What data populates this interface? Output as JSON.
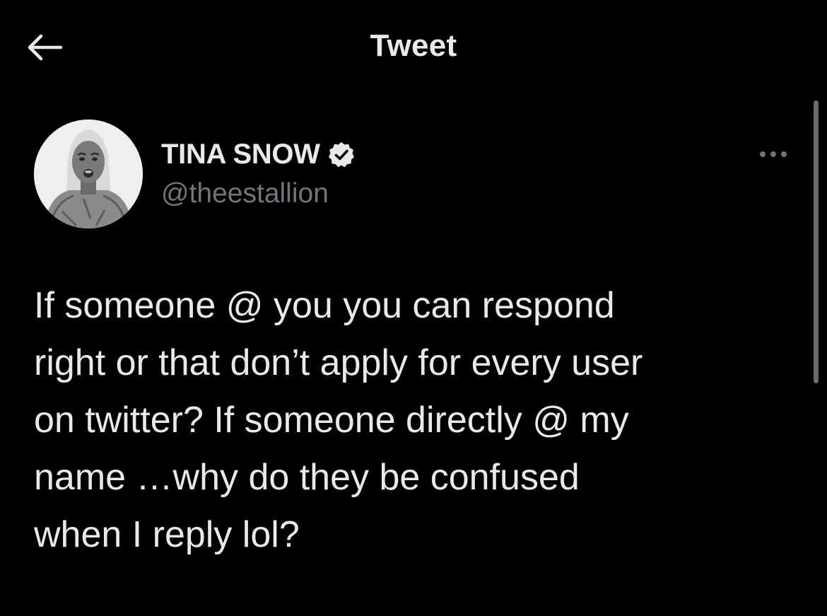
{
  "header": {
    "title": "Tweet",
    "back_icon": "arrow-left-icon"
  },
  "author": {
    "name": "TINA SNOW",
    "handle": "@theestallion",
    "verified": true,
    "verified_icon": "verified-badge-icon",
    "avatar_icon": "profile-photo"
  },
  "tweet": {
    "text": "If someone @ you you can respond\nright or that don’t apply for every user\non twitter? If someone directly @ my\nname …why do they be confused\nwhen I reply lol?"
  },
  "more_icon": "more-options-icon",
  "colors": {
    "background": "#000000",
    "primary_text": "#e7e9ea",
    "secondary_text": "#71767b",
    "scrollbar": "#6b6b6b"
  }
}
